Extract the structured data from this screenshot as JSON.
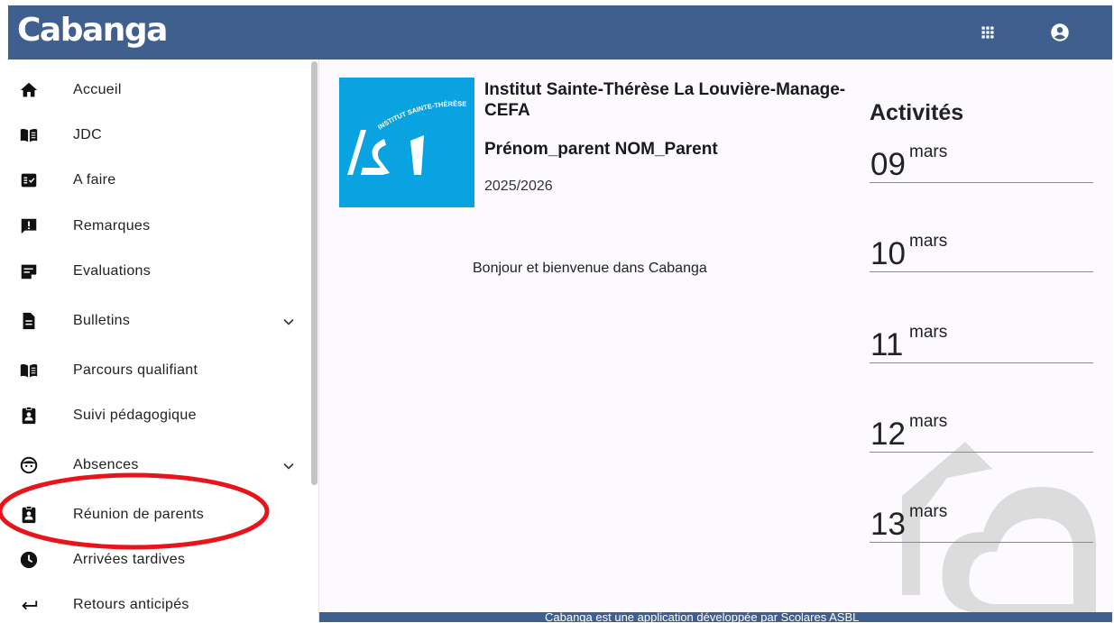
{
  "header": {
    "logo": "Cabanga",
    "icons": [
      "apps-grid-icon",
      "account-circle-icon"
    ],
    "color": "#3f5f8f"
  },
  "sidebar": {
    "items": [
      {
        "label": "Accueil",
        "icon": "home-icon"
      },
      {
        "label": "JDC",
        "icon": "book-icon"
      },
      {
        "label": "A faire",
        "icon": "checklist-icon"
      },
      {
        "label": "Remarques",
        "icon": "alert-comment-icon"
      },
      {
        "label": "Evaluations",
        "icon": "note-edit-icon"
      },
      {
        "label": "Bulletins",
        "icon": "document-icon",
        "expandable": true
      },
      {
        "label": "Parcours qualifiant",
        "icon": "book-icon"
      },
      {
        "label": "Suivi pédagogique",
        "icon": "clipboard-user-icon"
      },
      {
        "label": "Absences",
        "icon": "face-icon",
        "expandable": true
      },
      {
        "label": "Réunion de parents",
        "icon": "clipboard-user-icon",
        "highlighted": true
      },
      {
        "label": "Arrivées tardives",
        "icon": "clock-icon"
      },
      {
        "label": "Retours anticipés",
        "icon": "return-arrow-icon"
      }
    ]
  },
  "main": {
    "school_logo_text": "INSTITUT SAINTE-THÉRÈSE",
    "school_name": "Institut Sainte-Thérèse La Louvière-Manage-CEFA",
    "parent_name": "Prénom_parent NOM_Parent",
    "school_year": "2025/2026",
    "welcome": "Bonjour et bienvenue dans Cabanga"
  },
  "activities": {
    "title": "Activités",
    "days": [
      {
        "day": "09",
        "month": "mars"
      },
      {
        "day": "10",
        "month": "mars"
      },
      {
        "day": "11",
        "month": "mars"
      },
      {
        "day": "12",
        "month": "mars"
      },
      {
        "day": "13",
        "month": "mars"
      }
    ]
  },
  "footer": {
    "text": "Cabanga est une application développée par Scolares ASBL"
  },
  "colors": {
    "accent": "#3f5f8f",
    "logo_blue": "#0aa3e2",
    "annotation": "#e8141a"
  }
}
